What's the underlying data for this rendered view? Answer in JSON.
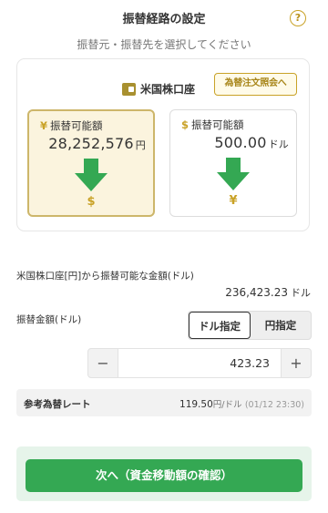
{
  "header": {
    "title": "振替経路の設定",
    "help_glyph": "?"
  },
  "subtitle": "振替元・振替先を選択してください",
  "account": {
    "name": "米国株口座",
    "fx_button": "為替注文照会へ"
  },
  "source_box": {
    "symbol": "¥",
    "label": "振替可能額",
    "amount": "28,252,576",
    "unit": "円",
    "target_symbol": "$",
    "selected": true
  },
  "dest_box": {
    "symbol": "$",
    "label": "振替可能額",
    "amount": "500.00",
    "unit": "ドル",
    "target_symbol": "¥",
    "selected": false
  },
  "available": {
    "label": "米国株口座[円]から振替可能な金額(ドル)",
    "amount": "236,423.23",
    "unit": "ドル"
  },
  "transfer": {
    "label": "振替金額(ドル)",
    "toggle_options": [
      "ドル指定",
      "円指定"
    ],
    "selected_option": "ドル指定",
    "minus": "−",
    "plus": "+",
    "value": "423.23"
  },
  "rate": {
    "label": "参考為替レート",
    "value": "119.50",
    "unit": "円/ドル",
    "timestamp": "(01/12 23:30)"
  },
  "next_button": "次へ（資金移動額の確認）",
  "colors": {
    "accent_gold": "#c9a227",
    "green": "#34a853",
    "green_bg": "#e6f4ea",
    "yen_box_bg": "#fbf4de"
  }
}
